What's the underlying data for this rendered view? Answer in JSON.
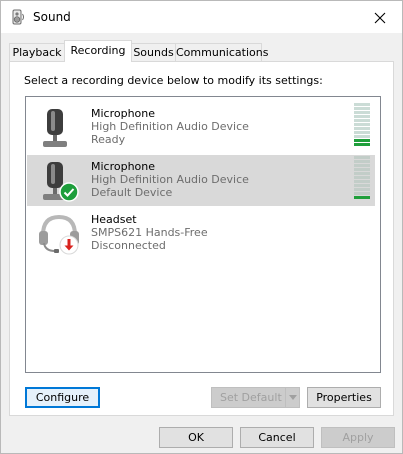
{
  "window": {
    "title": "Sound"
  },
  "tabs": [
    {
      "label": "Playback",
      "active": false
    },
    {
      "label": "Recording",
      "active": true
    },
    {
      "label": "Sounds",
      "active": false
    },
    {
      "label": "Communications",
      "active": false
    }
  ],
  "instruction": "Select a recording device below to modify its settings:",
  "devices": [
    {
      "name": "Microphone",
      "description": "High Definition Audio Device",
      "status": "Ready",
      "icon": "microphone-icon",
      "selected": false,
      "level_active_bars": 2,
      "level_total_bars": 11
    },
    {
      "name": "Microphone",
      "description": "High Definition Audio Device",
      "status": "Default Device",
      "icon": "microphone-icon",
      "badge": "default-check-icon",
      "selected": true,
      "level_active_bars": 1,
      "level_total_bars": 11
    },
    {
      "name": "Headset",
      "description": "SMPS621 Hands-Free",
      "status": "Disconnected",
      "icon": "headset-icon",
      "badge": "disconnected-arrow-icon",
      "selected": false
    }
  ],
  "buttons": {
    "configure": "Configure",
    "set_default": "Set Default",
    "properties": "Properties",
    "ok": "OK",
    "cancel": "Cancel",
    "apply": "Apply"
  },
  "colors": {
    "accent": "#0078d7",
    "level_on": "#1f9f3b",
    "default_badge": "#1e9e3c",
    "disconnected_badge": "#d9231f"
  }
}
